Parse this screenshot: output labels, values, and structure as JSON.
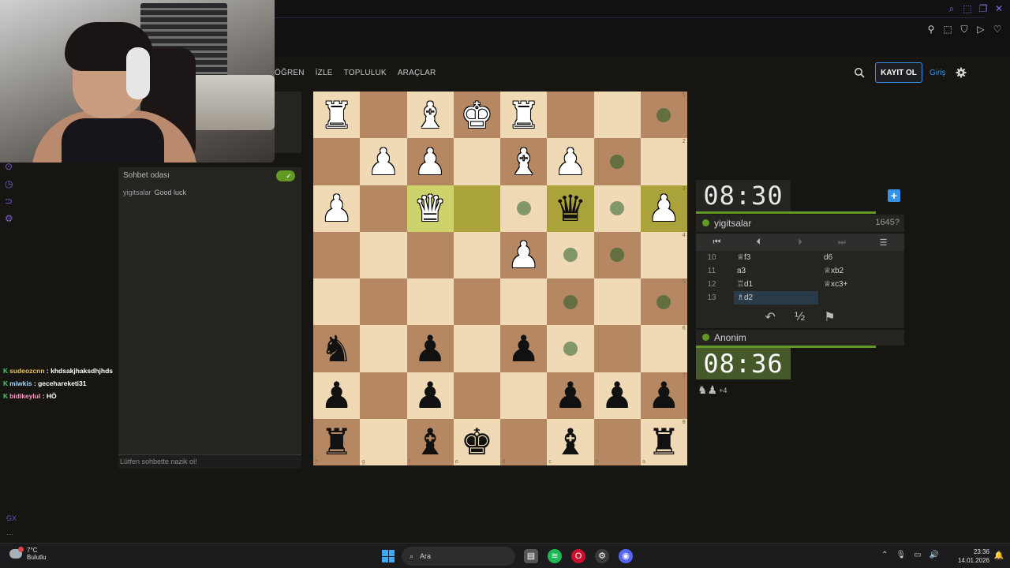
{
  "nav": {
    "items": [
      "ÖĞREN",
      "İZLE",
      "TOPLULUK",
      "ARAÇLAR"
    ],
    "signup": "KAYIT OL",
    "login": "Giriş"
  },
  "chat": {
    "title": "Sohbet odası",
    "message_user": "yigitsalar",
    "message_text": "Good luck",
    "input_placeholder": "Lütfen sohbette nazik ol!"
  },
  "stream_chat": [
    {
      "user": "sudeozcnn",
      "text": "khdsakjhaksdhjhds"
    },
    {
      "user": "miwkis",
      "text": "gecehareketi31"
    },
    {
      "user": "bidikeylul",
      "text": "HÖ"
    }
  ],
  "board": {
    "ranks": [
      "1",
      "2",
      "3",
      "4",
      "5",
      "6",
      "7",
      "8"
    ],
    "files": [
      "h",
      "g",
      "f",
      "e",
      "d",
      "c",
      "b",
      "a"
    ],
    "rows": [
      [
        "wR",
        "",
        "wB",
        "wK",
        "wR",
        "",
        "",
        "dot"
      ],
      [
        "",
        "wP",
        "wP",
        "",
        "wB",
        "wP",
        "dot",
        ""
      ],
      [
        "wP",
        "",
        "wQ",
        "hl",
        "dot",
        "bQ",
        "dot",
        "wP"
      ],
      [
        "",
        "",
        "",
        "",
        "wP",
        "dot",
        "dot",
        ""
      ],
      [
        "",
        "",
        "",
        "",
        "",
        "dot",
        "",
        "dot"
      ],
      [
        "bN",
        "",
        "bP",
        "",
        "bP",
        "dot",
        "",
        ""
      ],
      [
        "bP",
        "",
        "bP",
        "",
        "",
        "bP",
        "bP",
        "bP"
      ],
      [
        "bR",
        "",
        "bB",
        "bK",
        "",
        "bB",
        "",
        "bR"
      ]
    ],
    "highlights": [
      "2-2",
      "2-3",
      "2-5",
      "2-7"
    ]
  },
  "game": {
    "clock_top": "08:30",
    "clock_bottom": "08:36",
    "player_top": "yigitsalar",
    "player_top_rating": "1645?",
    "player_bottom": "Anonim",
    "captured_extra": "+4",
    "moves": [
      {
        "n": "10",
        "w": "♕f3",
        "b": "d6"
      },
      {
        "n": "11",
        "w": "a3",
        "b": "♕xb2"
      },
      {
        "n": "12",
        "w": "♖d1",
        "b": "♕xc3+"
      },
      {
        "n": "13",
        "w": "♗d2",
        "b": ""
      }
    ],
    "draw_label": "½"
  },
  "taskbar": {
    "temp": "7°C",
    "weather": "Bulutlu",
    "search": "Ara",
    "time": "23:36",
    "date": "14.01.2026"
  }
}
